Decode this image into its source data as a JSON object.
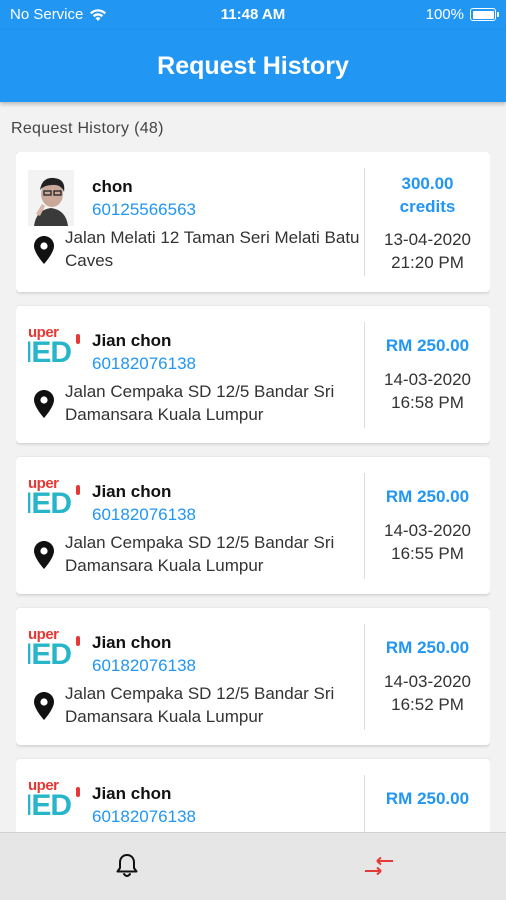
{
  "status_bar": {
    "carrier": "No Service",
    "time": "11:48 AM",
    "battery": "100%"
  },
  "app_bar": {
    "title": "Request History"
  },
  "history": {
    "count_label": "Request History (48)"
  },
  "requests": [
    {
      "name": "chon",
      "phone": "60125566563",
      "address": "Jalan Melati 12 Taman Seri Melati Batu Caves",
      "price": "300.00 credits",
      "date": "13-04-2020",
      "time": "21:20 PM",
      "avatar": "user-photo"
    },
    {
      "name": "Jian chon",
      "phone": "60182076138",
      "address": "Jalan Cempaka SD 12/5 Bandar Sri Damansara Kuala Lumpur",
      "price": "RM 250.00",
      "date": "14-03-2020",
      "time": "16:58 PM",
      "avatar": "supermed-logo"
    },
    {
      "name": "Jian chon",
      "phone": "60182076138",
      "address": "Jalan Cempaka SD 12/5 Bandar Sri Damansara Kuala Lumpur",
      "price": "RM 250.00",
      "date": "14-03-2020",
      "time": "16:55 PM",
      "avatar": "supermed-logo"
    },
    {
      "name": "Jian chon",
      "phone": "60182076138",
      "address": "Jalan Cempaka SD 12/5 Bandar Sri Damansara Kuala Lumpur",
      "price": "RM 250.00",
      "date": "14-03-2020",
      "time": "16:52 PM",
      "avatar": "supermed-logo"
    },
    {
      "name": "Jian chon",
      "phone": "60182076138",
      "address": "",
      "price": "RM 250.00",
      "date": "",
      "time": "",
      "avatar": "supermed-logo"
    }
  ],
  "supermed_logo": {
    "top_text": "uper",
    "bottom_text": "IED"
  },
  "bottom_nav": {
    "notifications_icon": "bell-icon",
    "history_icon": "transfer-arrows-icon",
    "active_color": "#e53935"
  },
  "colors": {
    "primary": "#2196f3",
    "link": "#2196f3"
  }
}
